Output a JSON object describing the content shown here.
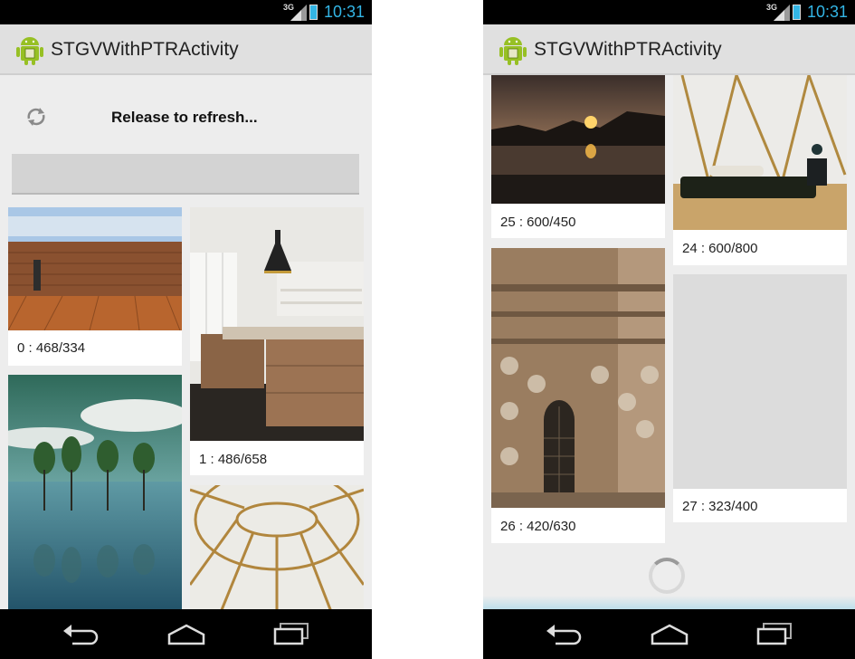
{
  "status_bar": {
    "time": "10:31",
    "network_label": "3G",
    "time_color": "#33b5e5"
  },
  "action_bar": {
    "title": "STGVWithPTRActivity",
    "icon": "android-robot-icon"
  },
  "left_screen": {
    "pull_to_refresh_text": "Release to refresh...",
    "refresh_icon": "refresh-icon",
    "items": [
      {
        "caption": "0 : 468/334",
        "image": "wooden deck facade"
      },
      {
        "caption": "1 : 486/658",
        "image": "modern kitchen island"
      },
      {
        "caption": "",
        "image": "lake with trees and mist"
      },
      {
        "caption": "",
        "image": "yurt roof structure"
      }
    ]
  },
  "right_screen": {
    "items": [
      {
        "caption": "25 : 600/450",
        "image": "sunset over lake"
      },
      {
        "caption": "24 : 600/800",
        "image": "yurt interior with bed"
      },
      {
        "caption": "26 : 420/630",
        "image": "ornate stone cathedral tower"
      },
      {
        "caption": "27 : 323/400",
        "image": "loading placeholder"
      }
    ],
    "loading_indicator": "spinner-icon"
  },
  "nav_bar": {
    "buttons": [
      "back-icon",
      "home-icon",
      "recent-apps-icon"
    ]
  }
}
